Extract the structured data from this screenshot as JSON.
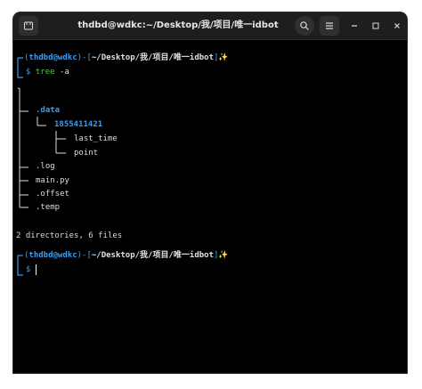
{
  "window": {
    "title": "thdbd@wdkc:~/Desktop/我/项目/唯一idbot"
  },
  "titlebar": {
    "icons": [
      "new-tab-icon",
      "search-icon",
      "menu-icon",
      "minimize-icon",
      "maximize-icon",
      "close-icon"
    ]
  },
  "prompt1": {
    "user_host": "thdbd@wdkc",
    "dash": "-",
    "path": "~/Desktop/我/项目/唯一idbot",
    "sparkle": "✨",
    "dollar": "$",
    "command": "tree",
    "args": "-a"
  },
  "tree": {
    "root": ".",
    "entries": [
      {
        "name": ".data",
        "type": "dir"
      },
      {
        "name": "1855411421",
        "type": "dir"
      },
      {
        "name": "last_time",
        "type": "file"
      },
      {
        "name": "point",
        "type": "file"
      },
      {
        "name": ".log",
        "type": "file"
      },
      {
        "name": "main.py",
        "type": "file"
      },
      {
        "name": ".offset",
        "type": "file"
      },
      {
        "name": ".temp",
        "type": "file"
      }
    ],
    "summary": "2 directories, 6 files"
  },
  "prompt2": {
    "user_host": "thdbd@wdkc",
    "dash": "-",
    "path": "~/Desktop/我/项目/唯一idbot",
    "sparkle": "✨",
    "dollar": "$"
  },
  "colors": {
    "prompt_blue": "#3a9df2",
    "command_green": "#57c24f",
    "sparkle_yellow": "#f7d24a",
    "background": "#000000",
    "titlebar": "#1e1e1e"
  }
}
